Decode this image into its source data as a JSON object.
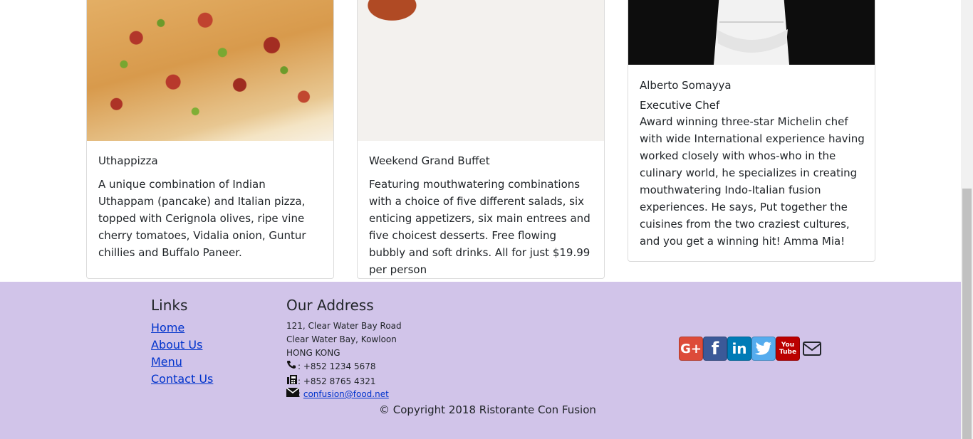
{
  "cards": [
    {
      "image": "pizza-image",
      "title": "Uthappizza",
      "text": "A unique combination of Indian Uthappam (pancake) and Italian pizza, topped with Cerignola olives, ripe vine cherry tomatoes, Vidalia onion, Guntur chillies and Buffalo Paneer."
    },
    {
      "image": "buffet-image",
      "title": "Weekend Grand Buffet",
      "text": "Featuring mouthwatering combinations with a choice of five different salads, six enticing appetizers, six main entrees and five choicest desserts. Free flowing bubbly and soft drinks. All for just $19.99 per person"
    },
    {
      "image": "chef-image",
      "title": "Alberto Somayya",
      "subtitle": "Executive Chef",
      "text": "Award winning three-star Michelin chef with wide International experience having worked closely with whos-who in the culinary world, he specializes in creating mouthwatering Indo-Italian fusion experiences. He says, Put together the cuisines from the two craziest cultures, and you get a winning hit! Amma Mia!"
    }
  ],
  "footer": {
    "links_heading": "Links",
    "links": [
      "Home",
      "About Us",
      "Menu",
      "Contact Us"
    ],
    "address_heading": "Our Address",
    "address_lines": [
      "121, Clear Water Bay Road",
      "Clear Water Bay, Kowloon",
      "HONG KONG"
    ],
    "phone": ": +852 1234 5678",
    "fax": ": +852 8765 4321",
    "email_sep": ": ",
    "email": "confusion@food.net",
    "social": [
      {
        "name": "google-plus-icon",
        "glyph": "G+",
        "color": "#dd4b39"
      },
      {
        "name": "facebook-icon",
        "glyph": "f",
        "color": "#3b5998"
      },
      {
        "name": "linkedin-icon",
        "glyph": "in",
        "color": "#007bb6"
      },
      {
        "name": "twitter-icon",
        "glyph": "t",
        "color": "#55acee"
      },
      {
        "name": "youtube-icon",
        "glyph": "You Tube",
        "color": "#bb0000"
      }
    ],
    "copyright": "© Copyright 2018 Ristorante Con Fusion"
  },
  "colors": {
    "footer_bg": "#d1c4e9",
    "link": "#0033cc"
  }
}
